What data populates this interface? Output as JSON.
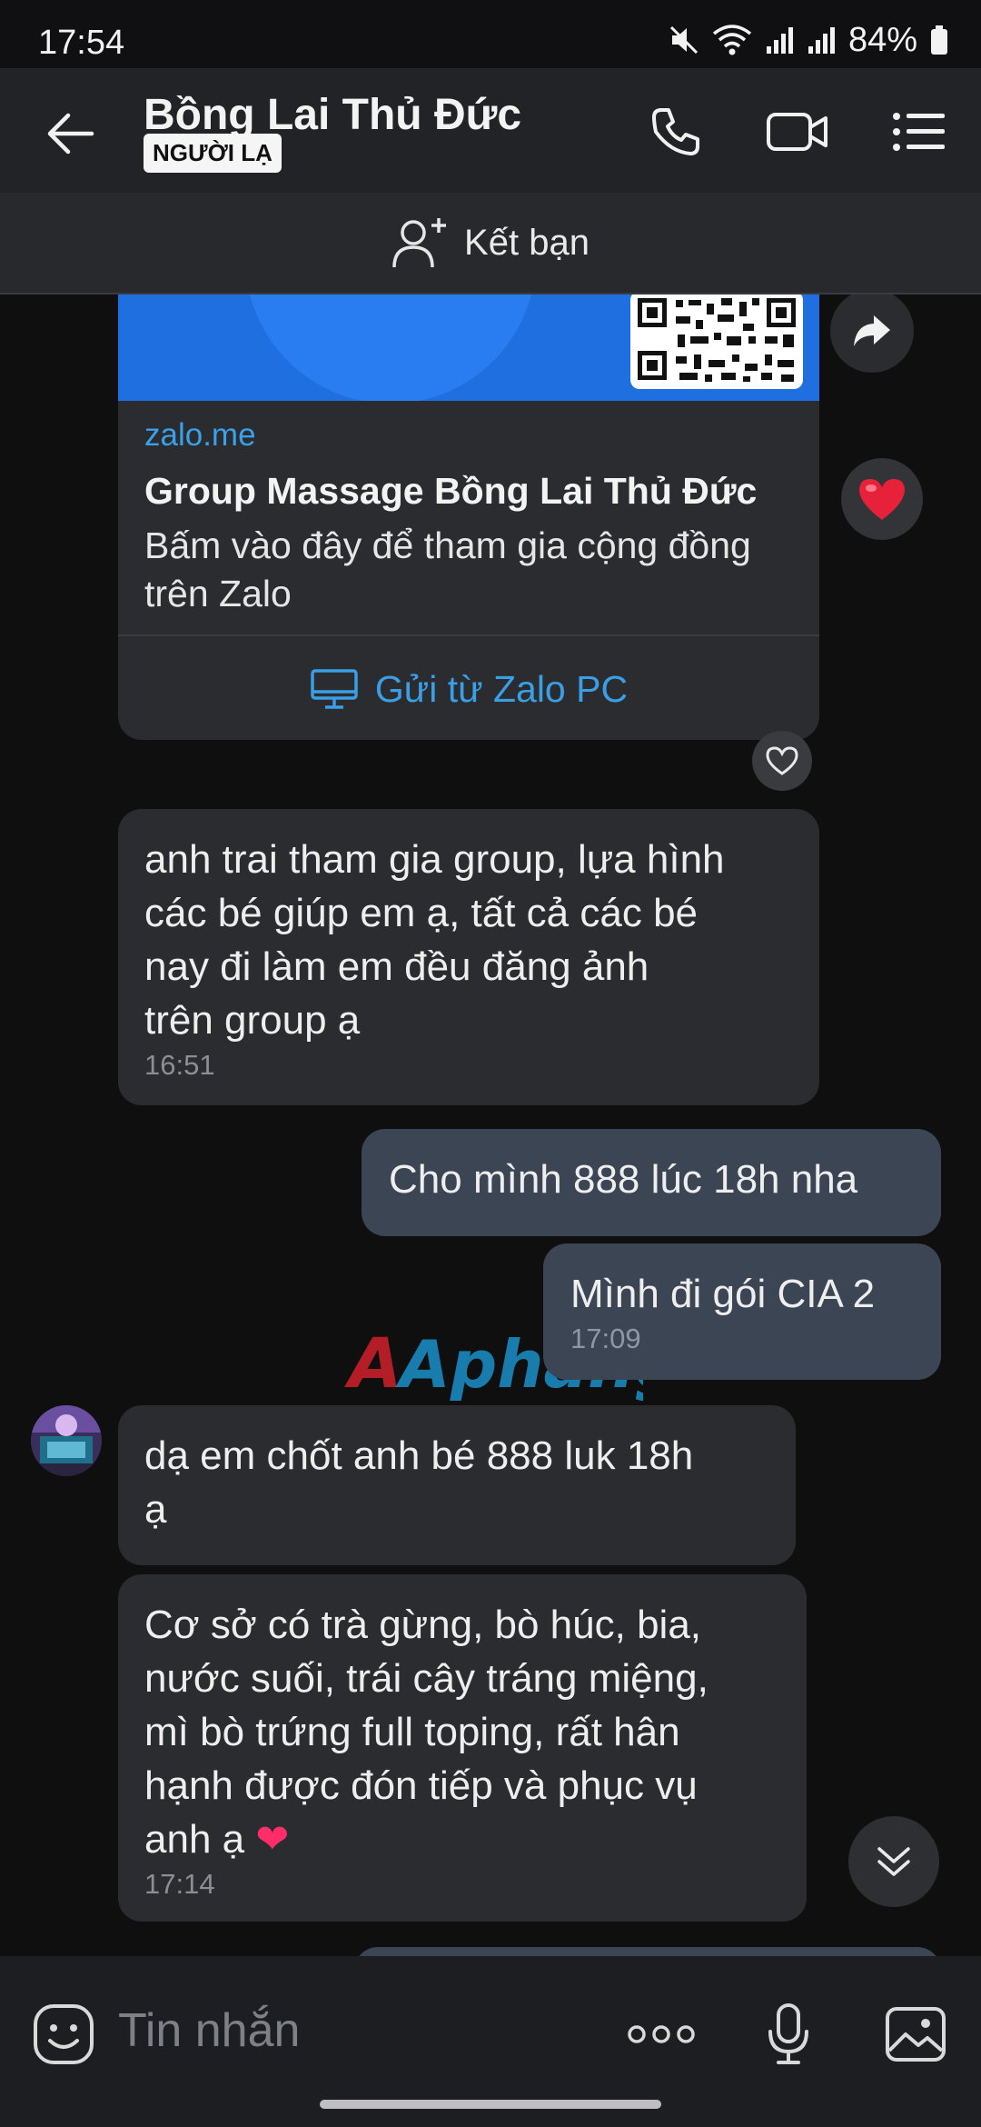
{
  "status_bar": {
    "time": "17:54",
    "battery": "84%"
  },
  "header": {
    "contact_name": "Bồng Lai Thủ Đức",
    "badge": "NGƯỜI LẠ"
  },
  "add_friend": {
    "label": "Kết bạn"
  },
  "link_card": {
    "domain": "zalo.me",
    "title": "Group Massage Bồng Lai Thủ Đức",
    "description": "Bấm vào đây để tham gia cộng đồng trên Zalo",
    "source_label": "Gửi từ Zalo PC"
  },
  "messages": [
    {
      "direction": "incoming",
      "lines": [
        "anh trai tham gia group, lựa hình",
        "các bé giúp em ạ, tất cả các bé",
        "nay đi làm em đều đăng ảnh",
        "trên group ạ"
      ],
      "time": "16:51"
    },
    {
      "direction": "outgoing",
      "text": "Cho mình 888 lúc 18h nha"
    },
    {
      "direction": "outgoing",
      "text": "Mình đi gói CIA 2",
      "time": "17:09"
    },
    {
      "direction": "incoming",
      "lines": [
        "dạ em chốt anh bé 888 luk 18h",
        "ạ"
      ]
    },
    {
      "direction": "incoming",
      "lines": [
        "Cơ sở có trà gừng, bò húc, bia,",
        "nước suối, trái cây tráng miệng,",
        "mì bò trứng full toping, rất hân",
        "hạnh được đón tiếp và phục vụ",
        "anh ạ"
      ],
      "emoji": "❤",
      "time": "17:14"
    }
  ],
  "watermark": "Aphang",
  "composer": {
    "placeholder": "Tin nhắn"
  },
  "icons": {
    "back": "arrow-left-icon",
    "call": "phone-icon",
    "video": "video-camera-icon",
    "menu": "list-menu-icon",
    "add_friend": "add-person-icon",
    "share": "share-arrow-icon",
    "reaction": "red-heart-icon",
    "like": "heart-outline-icon",
    "scroll": "chevron-double-down-icon",
    "sticker": "emoji-icon",
    "more": "more-dots-icon",
    "mic": "microphone-icon",
    "image": "image-icon",
    "pc": "monitor-icon"
  },
  "colors": {
    "accent": "#3a9fe6",
    "outgoing_bubble": "#3c4553",
    "incoming_bubble": "#2b2c2f",
    "banner": "#1f6fe0",
    "heart": "#e8213a"
  }
}
